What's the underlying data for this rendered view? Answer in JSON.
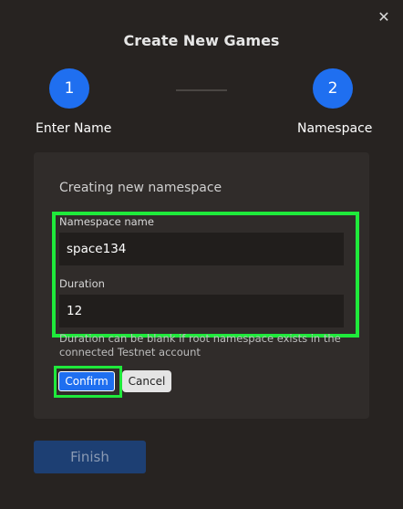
{
  "modal": {
    "title": "Create New Games",
    "close_icon": "close-icon"
  },
  "stepper": {
    "steps": [
      {
        "number": "1",
        "label": "Enter Name"
      },
      {
        "number": "2",
        "label": "Namespace"
      }
    ]
  },
  "form": {
    "heading": "Creating new namespace",
    "namespace_label": "Namespace name",
    "namespace_value": "space134",
    "duration_label": "Duration",
    "duration_value": "12",
    "helper": "Duration can be blank if root namespace exists in the connected Testnet account",
    "confirm_label": "Confirm",
    "cancel_label": "Cancel"
  },
  "footer": {
    "finish_label": "Finish"
  },
  "colors": {
    "background": "#272321",
    "panel": "#302c2a",
    "accent": "#1f6ff0",
    "highlight": "#1fea3b"
  }
}
